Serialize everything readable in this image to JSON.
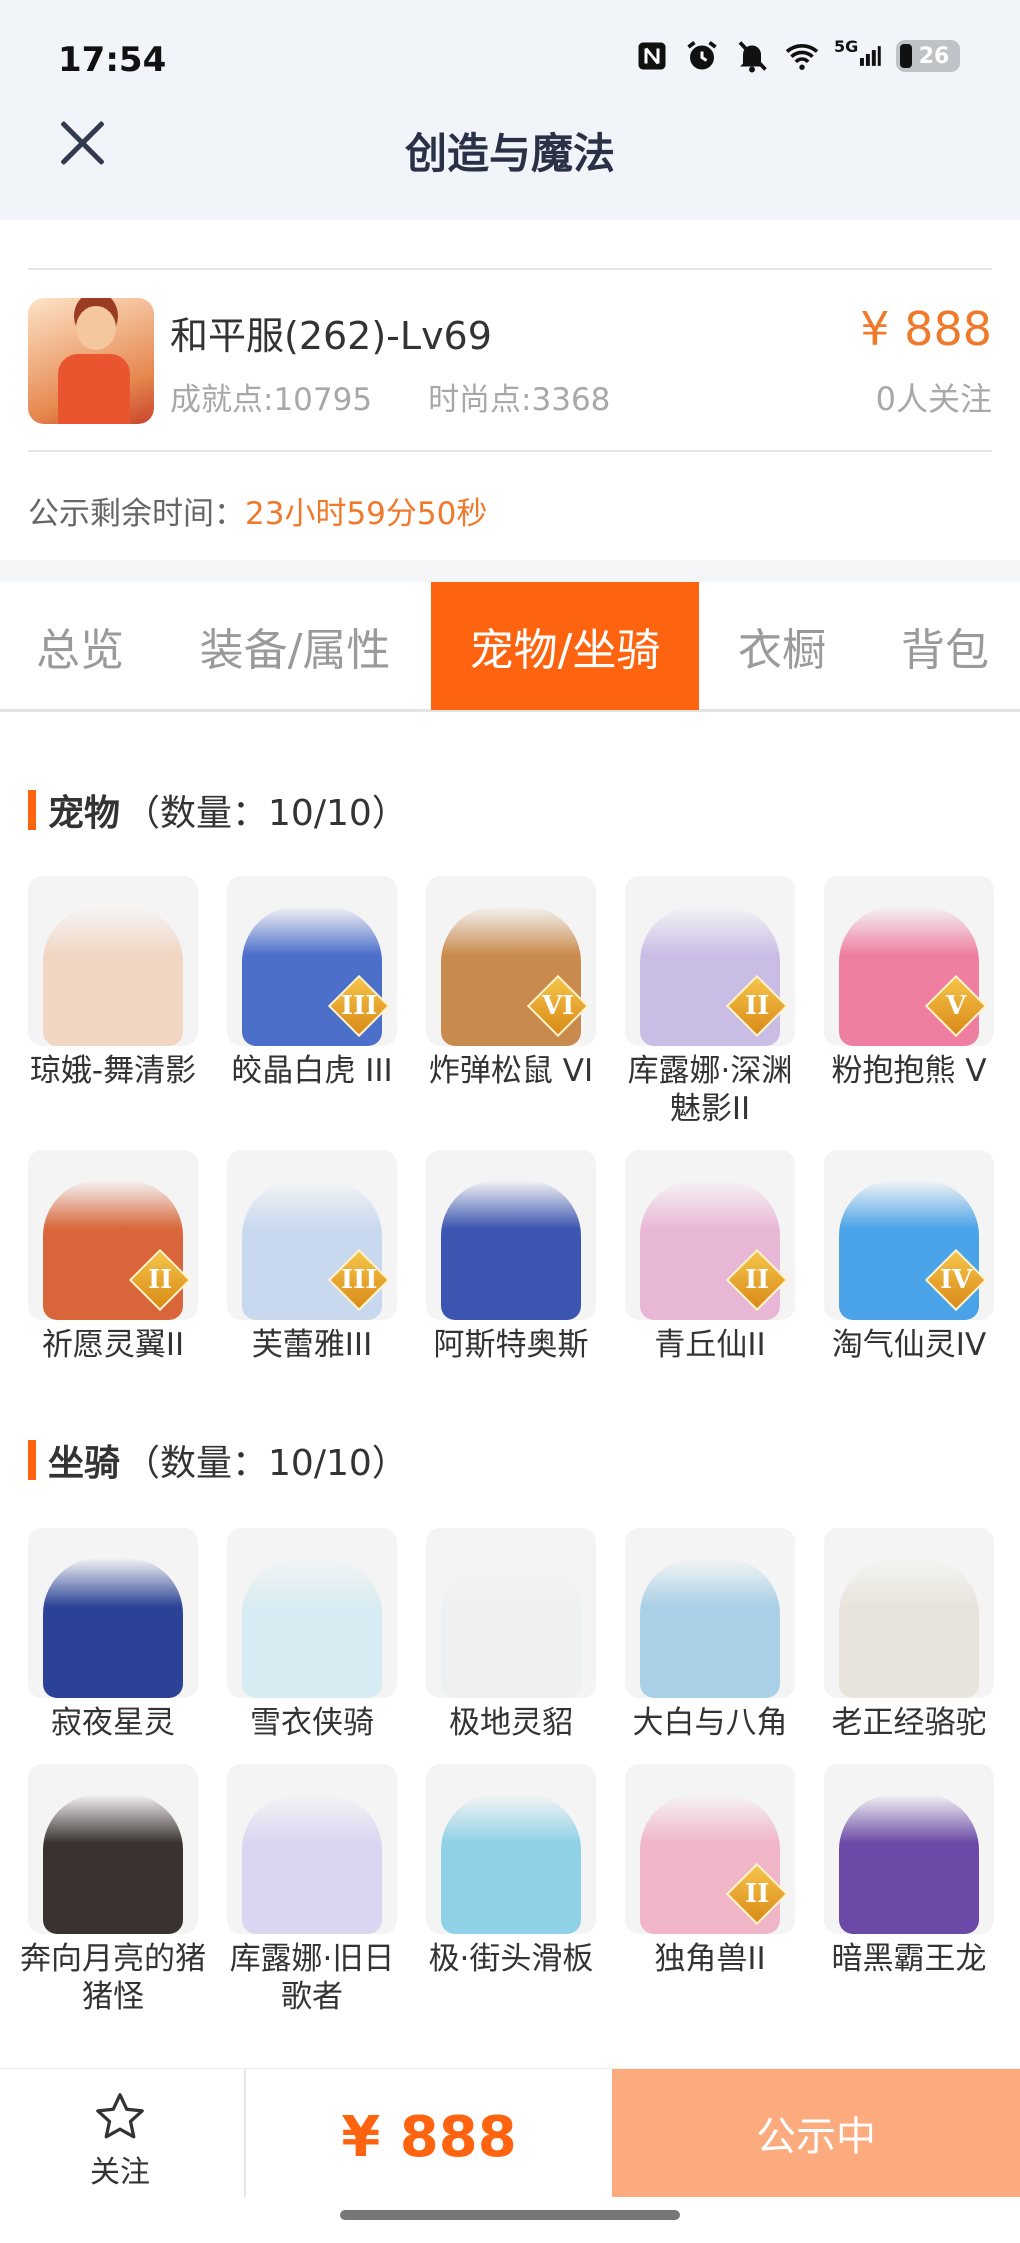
{
  "status_bar": {
    "time": "17:54",
    "network": "5G",
    "battery": "26"
  },
  "header": {
    "title": "创造与魔法"
  },
  "listing": {
    "server_level": "和平服(262)-Lv69",
    "achievement": "成就点:10795",
    "fashion": "时尚点:3368",
    "price": "¥ 888",
    "followers": "0人关注",
    "countdown_label": "公示剩余时间：",
    "countdown_value": "23小时59分50秒"
  },
  "tabs": [
    {
      "label": "总览",
      "active": false
    },
    {
      "label": "装备/属性",
      "active": false
    },
    {
      "label": "宠物/坐骑",
      "active": true
    },
    {
      "label": "衣橱",
      "active": false
    },
    {
      "label": "背包",
      "active": false
    }
  ],
  "pets": {
    "title": "宠物",
    "count": "（数量：10/10）",
    "items": [
      {
        "name": "琼娥-舞清影",
        "rank": "",
        "color": "#f2d6c4"
      },
      {
        "name": "皎晶白虎 III",
        "rank": "III",
        "color": "#4c6fc9"
      },
      {
        "name": "炸弹松鼠 VI",
        "rank": "VI",
        "color": "#c98b4d"
      },
      {
        "name": "库露娜·深渊魅影II",
        "rank": "II",
        "color": "#c9bde6"
      },
      {
        "name": "粉抱抱熊 V",
        "rank": "V",
        "color": "#ee7fa0"
      },
      {
        "name": "祈愿灵翼II",
        "rank": "II",
        "color": "#d8663a"
      },
      {
        "name": "芙蕾雅III",
        "rank": "III",
        "color": "#c8d8ef"
      },
      {
        "name": "阿斯特奥斯",
        "rank": "",
        "color": "#3c55b0"
      },
      {
        "name": "青丘仙II",
        "rank": "II",
        "color": "#e9b7d6"
      },
      {
        "name": "淘气仙灵IV",
        "rank": "IV",
        "color": "#4aa3e8"
      }
    ]
  },
  "mounts": {
    "title": "坐骑",
    "count": "（数量：10/10）",
    "items": [
      {
        "name": "寂夜星灵",
        "rank": "",
        "color": "#2b4296"
      },
      {
        "name": "雪衣侠骑",
        "rank": "",
        "color": "#d7ecf2"
      },
      {
        "name": "极地灵貂",
        "rank": "",
        "color": "#eef0f2"
      },
      {
        "name": "大白与八角",
        "rank": "",
        "color": "#a9d0e6"
      },
      {
        "name": "老正经骆驼",
        "rank": "",
        "color": "#e8e4dc"
      },
      {
        "name": "奔向月亮的猪猪怪",
        "rank": "",
        "color": "#3a3230"
      },
      {
        "name": "库露娜·旧日歌者",
        "rank": "",
        "color": "#d9d6f2"
      },
      {
        "name": "极·街头滑板",
        "rank": "",
        "color": "#8fd1e6"
      },
      {
        "name": "独角兽II",
        "rank": "II",
        "color": "#f0b6c8"
      },
      {
        "name": "暗黑霸王龙",
        "rank": "",
        "color": "#6a4aa6"
      }
    ]
  },
  "bottom_bar": {
    "follow_label": "关注",
    "price": "¥ 888",
    "button_label": "公示中"
  },
  "colors": {
    "accent": "#fe6410",
    "price": "#f07a2b",
    "button_disabled": "#fcab7e"
  }
}
